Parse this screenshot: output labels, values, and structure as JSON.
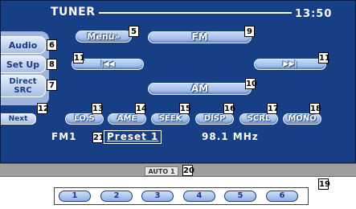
{
  "header": {
    "title": "TUNER",
    "clock": "13:50"
  },
  "sidebar": {
    "audio": "Audio",
    "setup": "Set Up",
    "direct_src": "Direct\nSRC",
    "next": "Next"
  },
  "buttons": {
    "menu": "Menu»",
    "fm": "FM",
    "am": "AM",
    "prev_icon": "|◀◀",
    "next_icon": "▶▶|",
    "los": "LO.S",
    "ame": "AME",
    "seek": "SEEK",
    "disp": "DISP",
    "scrl": "SCRL",
    "mono": "MONO"
  },
  "info": {
    "band": "FM1",
    "preset": "Preset 1",
    "freq": "98.1 MHz"
  },
  "status": {
    "auto": "AUTO 1"
  },
  "presets": [
    "1",
    "2",
    "3",
    "4",
    "5",
    "6"
  ],
  "callouts": {
    "c5": "5",
    "c6": "6",
    "c7": "7",
    "c8": "8",
    "c9": "9",
    "c10": "10",
    "c11a": "11",
    "c11b": "11",
    "c12": "12",
    "c13": "13",
    "c14": "14",
    "c15": "15",
    "c16": "16",
    "c17": "17",
    "c18": "18",
    "c19": "19",
    "c20": "20",
    "c21": "21"
  }
}
